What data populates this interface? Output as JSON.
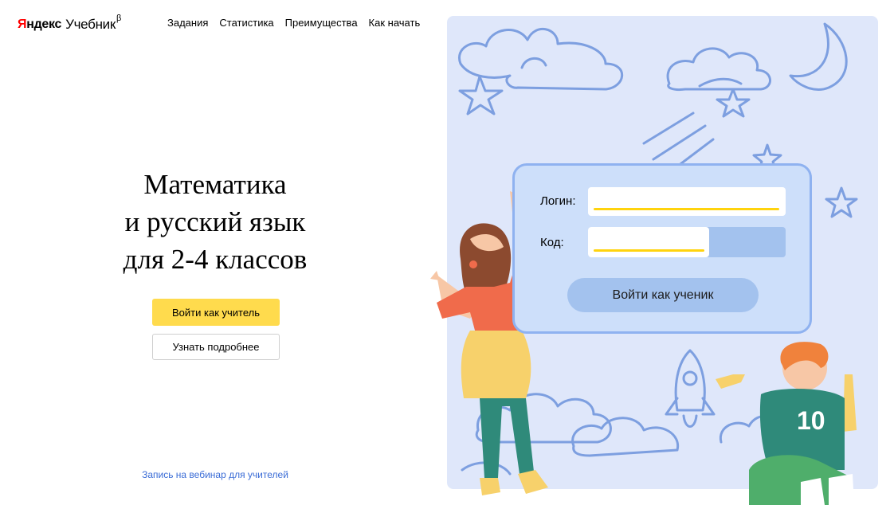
{
  "header": {
    "logo_brand_first": "Я",
    "logo_brand_rest": "ндекс",
    "logo_product": "Учебник",
    "logo_beta": "β",
    "nav": [
      {
        "label": "Задания"
      },
      {
        "label": "Статистика"
      },
      {
        "label": "Преимущества"
      },
      {
        "label": "Как начать"
      }
    ]
  },
  "hero": {
    "title_lines": [
      "Математика",
      "и русский язык",
      "для 2-4 классов"
    ],
    "teacher_button": "Войти как учитель",
    "more_button": "Узнать подробнее",
    "webinar_link": "Запись на вебинар для учителей"
  },
  "login_form": {
    "login_label": "Логин:",
    "login_value": "",
    "code_label": "Код:",
    "code_value": "",
    "submit_label": "Войти как ученик"
  },
  "jersey_number": "10",
  "colors": {
    "accent_yellow": "#ffdb4d",
    "panel_bg": "#dfe7fa",
    "card_border": "#8fb2f0",
    "student_button": "#a3c2ee",
    "link_blue": "#3a6cd6"
  }
}
